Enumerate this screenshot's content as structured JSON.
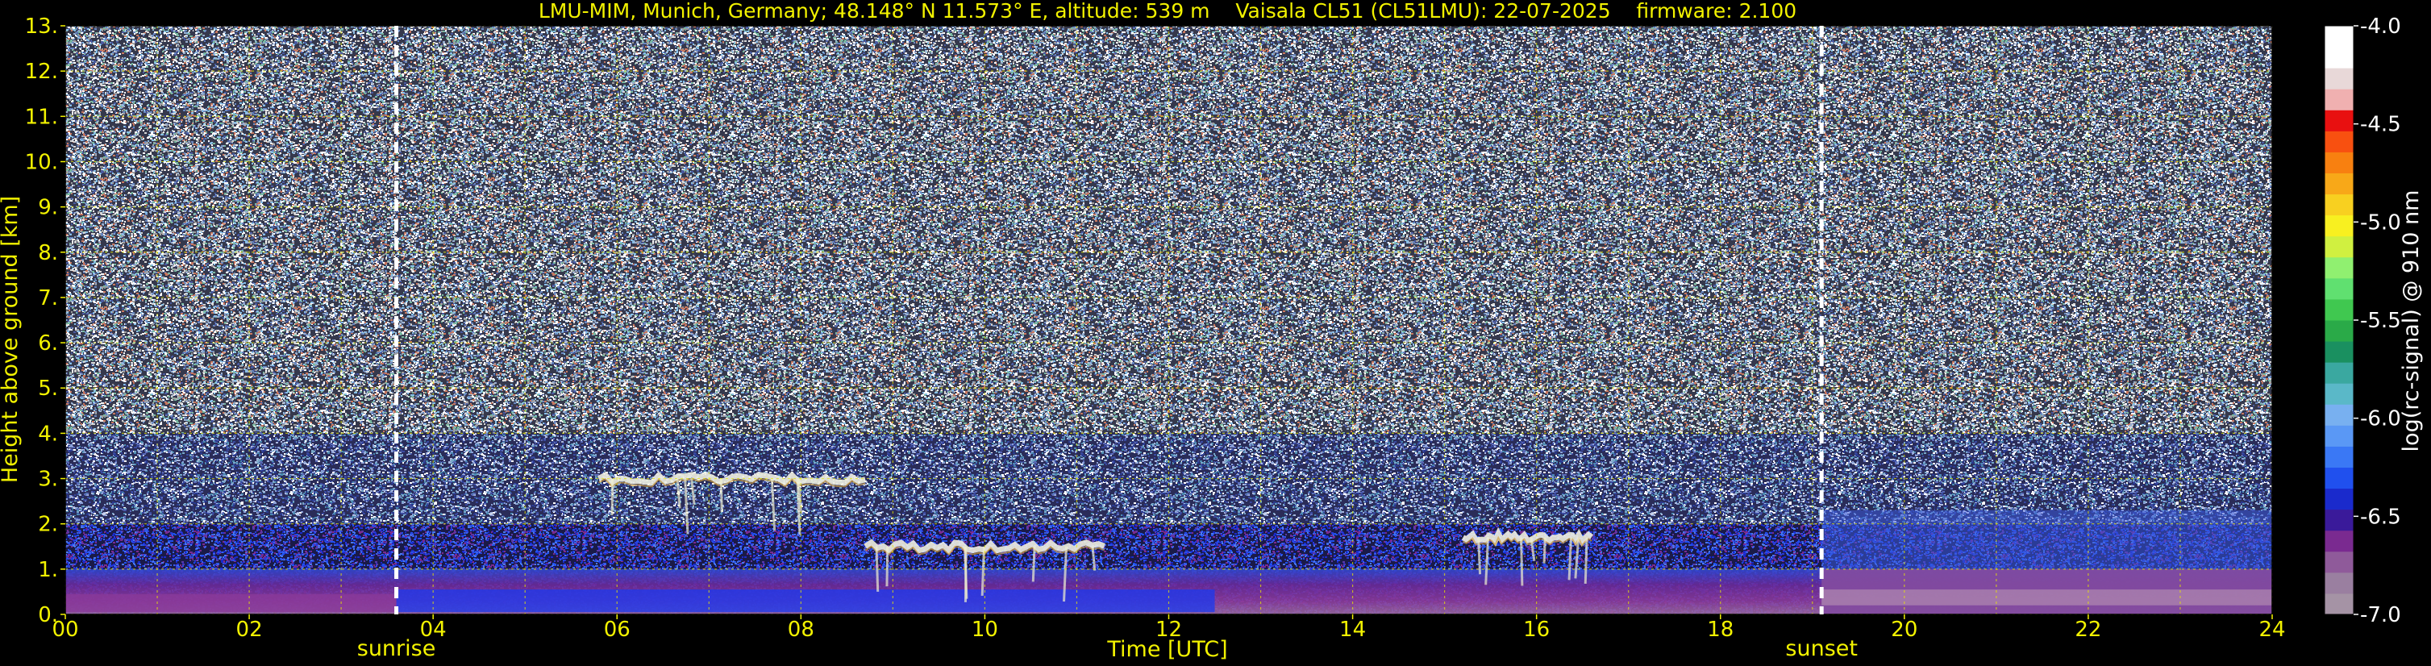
{
  "chart_data": {
    "type": "heatmap",
    "title": "LMU-MIM, Munich, Germany; 48.148° N 11.573° E, altitude: 539 m    Vaisala CL51 (CL51LMU): 22-07-2025    firmware: 2.100",
    "xlabel": "Time [UTC]",
    "ylabel": "Height above ground [km]",
    "xlim": [
      0,
      24
    ],
    "ylim": [
      0,
      13
    ],
    "x_ticks": [
      "00",
      "02",
      "04",
      "06",
      "08",
      "10",
      "12",
      "14",
      "16",
      "18",
      "20",
      "22",
      "24"
    ],
    "y_ticks": [
      "0.",
      "1.",
      "2.",
      "3.",
      "4.",
      "5.",
      "6.",
      "7.",
      "8.",
      "9.",
      "10.",
      "11.",
      "12.",
      "13."
    ],
    "grid": true,
    "annotations": [
      {
        "label": "sunrise",
        "time": 3.6
      },
      {
        "label": "sunset",
        "time": 19.1
      }
    ],
    "colorbar": {
      "label": "log(rc-signal) @ 910 nm",
      "range": [
        -7.0,
        -4.0
      ],
      "ticks": [
        "-4.0",
        "-4.5",
        "-5.0",
        "-5.5",
        "-6.0",
        "-6.5",
        "-7.0"
      ],
      "colors": [
        "#a593a5",
        "#9a7fa0",
        "#8f5a9a",
        "#7a2a90",
        "#3a1a9a",
        "#1a2acc",
        "#2050ee",
        "#3a78f5",
        "#5a98f5",
        "#78b0f0",
        "#5ab8c8",
        "#3aa8a0",
        "#1a9060",
        "#2aaa48",
        "#40c850",
        "#60e070",
        "#90f070",
        "#d0f040",
        "#f8f020",
        "#f8d020",
        "#f8a818",
        "#f88010",
        "#f85010",
        "#e81010",
        "#f0b0b0",
        "#e8d8d8",
        "#ffffff",
        "#ffffff"
      ]
    },
    "features": [
      {
        "type": "boundary_layer",
        "time_range": [
          0,
          24
        ],
        "height_km": [
          0,
          1.0
        ]
      },
      {
        "type": "cloud_layer",
        "time_range": [
          5.8,
          8.7
        ],
        "height_km": 3.0
      },
      {
        "type": "cloud_layer",
        "time_range": [
          8.7,
          11.3
        ],
        "height_km": 1.5
      },
      {
        "type": "cloud_layer",
        "time_range": [
          15.2,
          16.6
        ],
        "height_km": 1.7
      },
      {
        "type": "aerosol_layer",
        "time_range": [
          19.1,
          24
        ],
        "height_km": [
          0,
          2.3
        ]
      }
    ]
  }
}
